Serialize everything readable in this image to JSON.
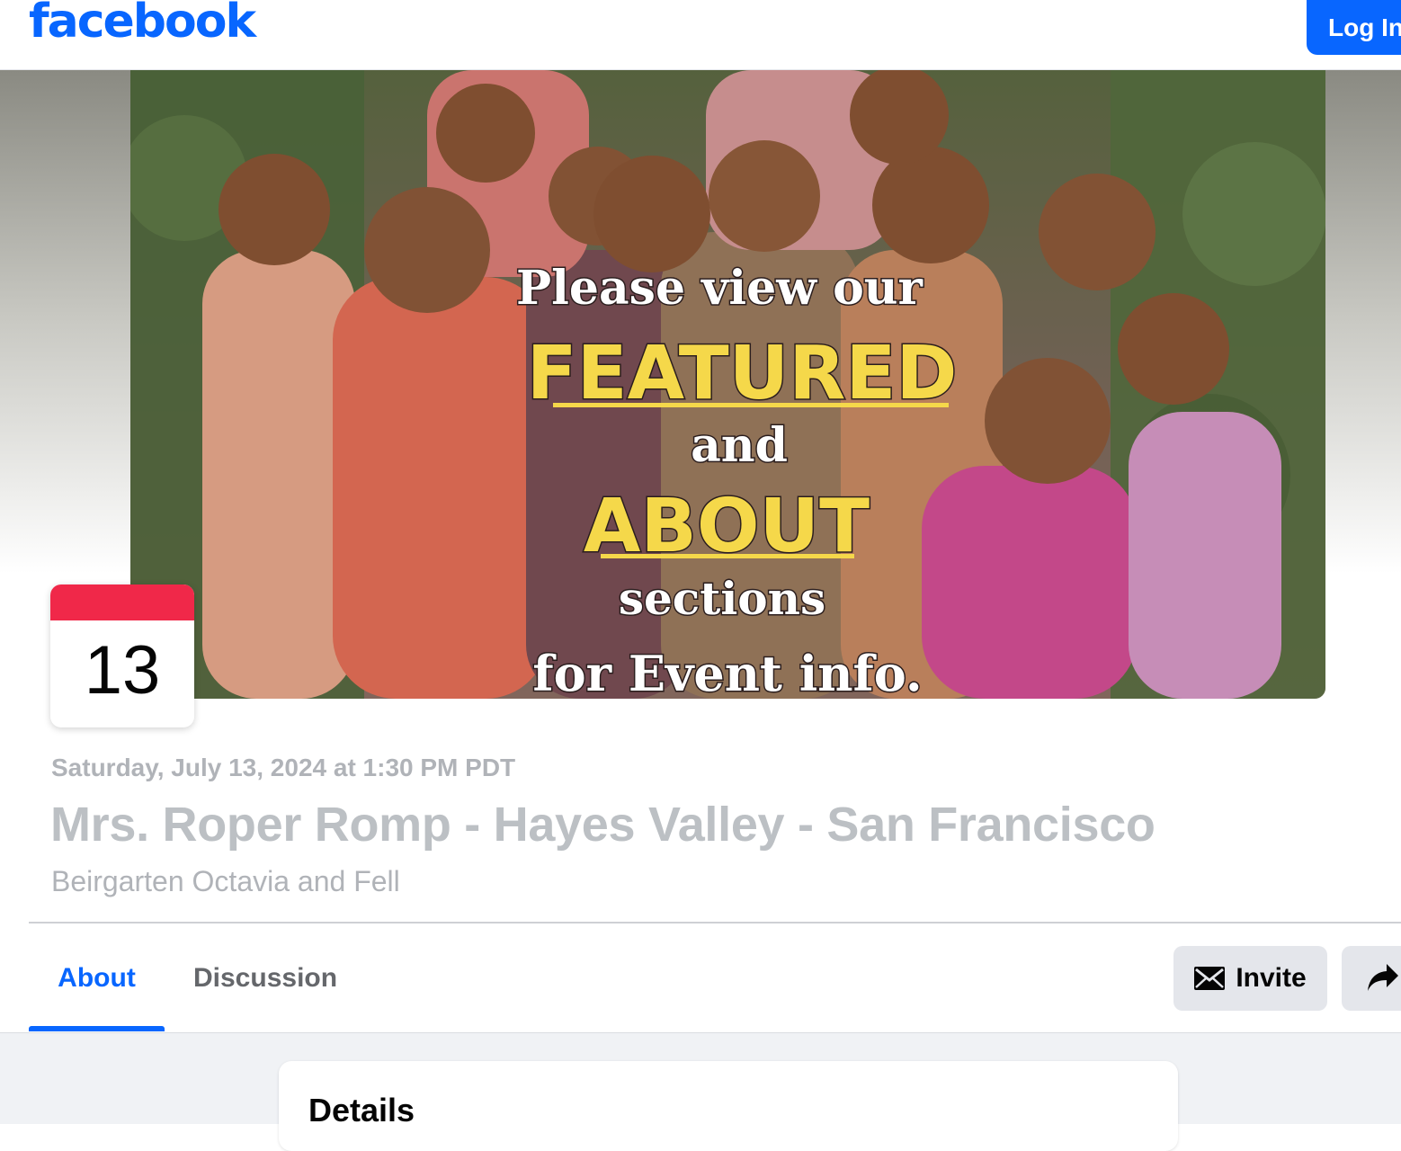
{
  "header": {
    "logo_text": "facebook",
    "login_label": "Log In"
  },
  "cover": {
    "overlay_line1": "Please view our",
    "overlay_line2": "FEATURED",
    "overlay_line3": "and",
    "overlay_line4": "ABOUT",
    "overlay_line5": "sections",
    "overlay_line6": "for Event info."
  },
  "event": {
    "day": "13",
    "date_time": "Saturday, July 13, 2024 at 1:30 PM PDT",
    "title": "Mrs. Roper Romp - Hayes Valley - San Francisco",
    "location": "Beirgarten Octavia and Fell"
  },
  "tabs": [
    {
      "label": "About",
      "active": true
    },
    {
      "label": "Discussion",
      "active": false
    }
  ],
  "actions": {
    "invite_label": "Invite"
  },
  "details": {
    "title": "Details"
  },
  "colors": {
    "brand_blue": "#0866ff",
    "calendar_red": "#f02849",
    "overlay_yellow": "#f5d84a"
  }
}
